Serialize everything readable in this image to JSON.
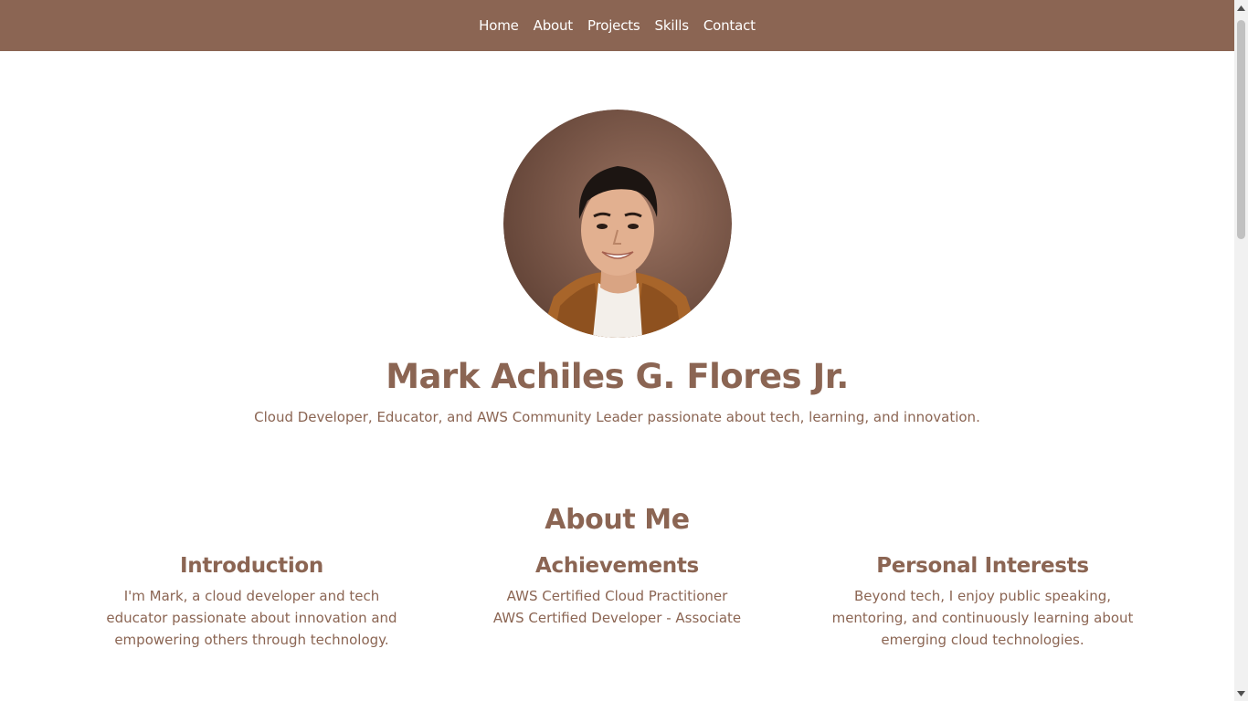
{
  "nav": {
    "items": [
      {
        "label": "Home"
      },
      {
        "label": "About"
      },
      {
        "label": "Projects"
      },
      {
        "label": "Skills"
      },
      {
        "label": "Contact"
      }
    ]
  },
  "hero": {
    "name": "Mark Achiles G. Flores Jr.",
    "tagline": "Cloud Developer, Educator, and AWS Community Leader passionate about tech, learning, and innovation."
  },
  "about": {
    "title": "About Me",
    "columns": [
      {
        "heading": "Introduction",
        "text": "I'm Mark, a cloud developer and tech educator passionate about innovation and empowering others through technology."
      },
      {
        "heading": "Achievements",
        "lines": [
          "AWS Certified Cloud Practitioner",
          "AWS Certified Developer - Associate"
        ]
      },
      {
        "heading": "Personal Interests",
        "text": "Beyond tech, I enjoy public speaking, mentoring, and continuously learning about emerging cloud technologies."
      }
    ]
  },
  "colors": {
    "brand": "#8b6553",
    "background": "#ffffff"
  },
  "icons": {
    "scroll_up": "triangle-up-icon",
    "scroll_down": "triangle-down-icon"
  }
}
